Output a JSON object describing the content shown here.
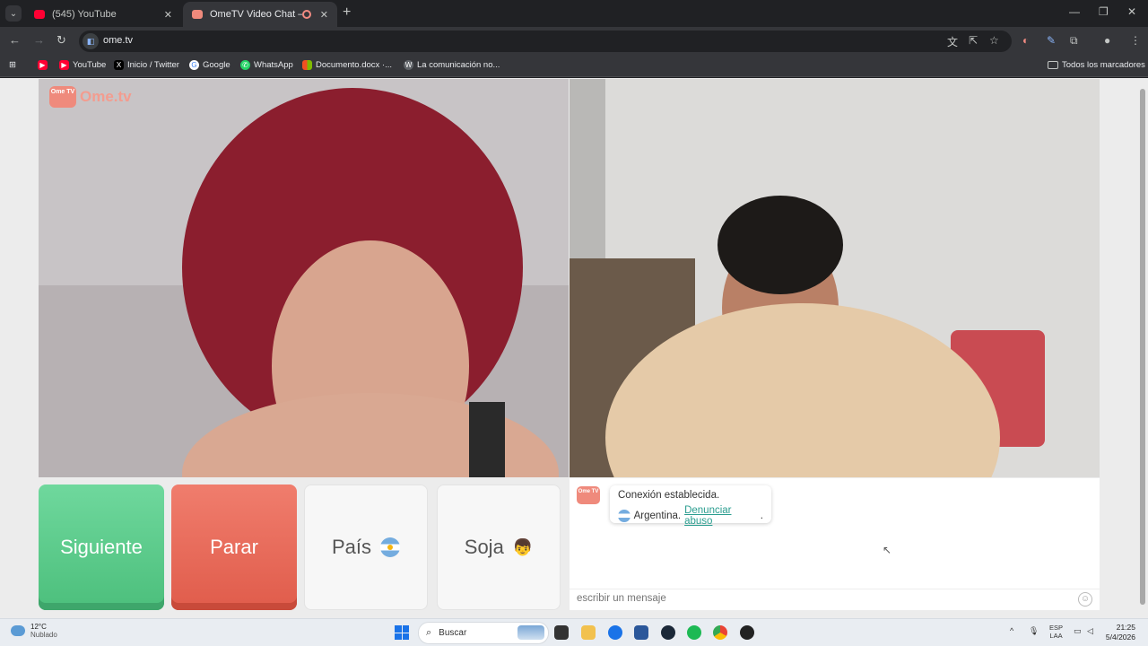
{
  "browser": {
    "tabs": [
      {
        "title": "(545) YouTube",
        "active": false,
        "favicon_color": "#ff0033"
      },
      {
        "title": "OmeTV Video Chat — Alte",
        "active": true,
        "favicon_color": "#ef8a7c"
      }
    ],
    "new_tab_label": "+",
    "url": "ome.tv",
    "bookmarks": [
      {
        "label": "YouTube",
        "icon": "youtube-icon"
      },
      {
        "label": "Inicio / Twitter",
        "icon": "x-icon"
      },
      {
        "label": "Google",
        "icon": "google-icon"
      },
      {
        "label": "WhatsApp",
        "icon": "whatsapp-icon"
      },
      {
        "label": "Documento.docx ·...",
        "icon": "office-icon"
      },
      {
        "label": "La comunicación no...",
        "icon": "wordpress-icon"
      }
    ],
    "all_bookmarks_label": "Todos los marcadores"
  },
  "ometv": {
    "logo_small": "Ome TV",
    "logo_text": "Ome.tv",
    "buttons": {
      "next": "Siguiente",
      "stop": "Parar",
      "country": "País",
      "gender": "Soja"
    },
    "chat": {
      "connection_msg": "Conexión establecida.",
      "country": "Argentina",
      "separator": " .",
      "report_link": "Denunciar abuso",
      "period": ".",
      "input_placeholder": "escribir un mensaje"
    },
    "colors": {
      "next": "#5fcf8c",
      "stop": "#e86a59",
      "brand": "#ef8a7c"
    }
  },
  "taskbar": {
    "weather_temp": "12°C",
    "weather_desc": "Nublado",
    "search_label": "Buscar",
    "language": "ESP",
    "language_sub": "LAA",
    "time": "21:25",
    "date": "5/4/2026"
  }
}
